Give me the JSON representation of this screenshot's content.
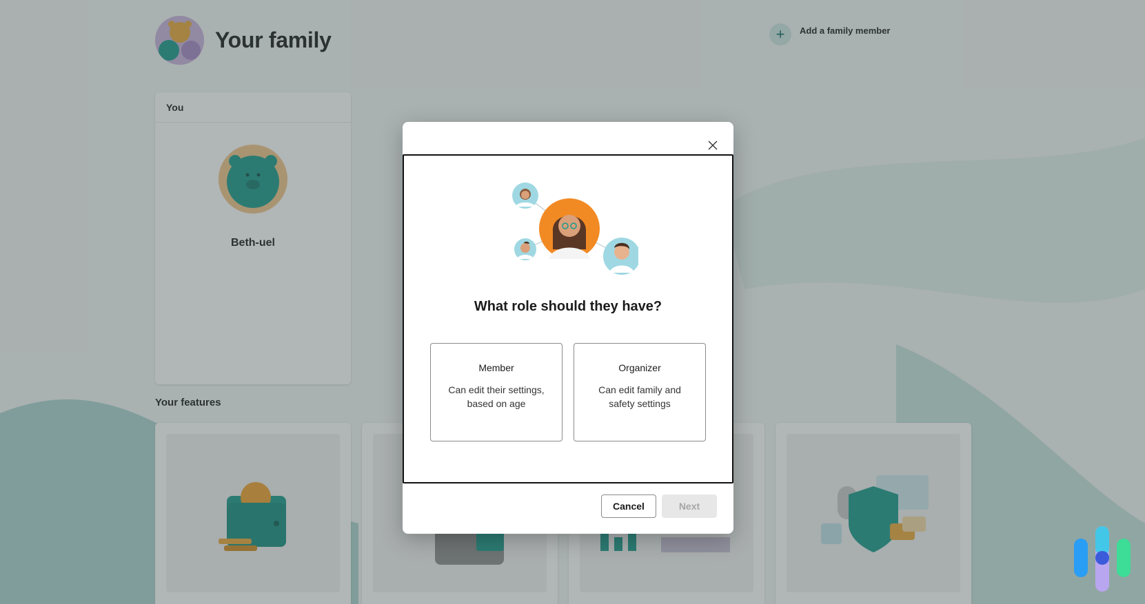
{
  "header": {
    "title": "Your family",
    "add_member_label": "Add a family member",
    "add_icon": "plus-icon"
  },
  "you_card": {
    "heading": "You",
    "name": "Beth-uel"
  },
  "features": {
    "title": "Your features"
  },
  "dialog": {
    "question": "What role should they have?",
    "close_icon": "close-icon",
    "roles": [
      {
        "title": "Member",
        "description": "Can edit their settings, based on age"
      },
      {
        "title": "Organizer",
        "description": "Can edit family and safety settings"
      }
    ],
    "cancel_label": "Cancel",
    "next_label": "Next",
    "next_enabled": false
  },
  "colors": {
    "accent_teal": "#0f8a80",
    "overlay": "#46505080",
    "orange": "#f28a24"
  }
}
